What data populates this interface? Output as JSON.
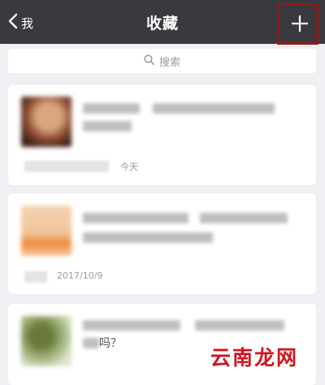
{
  "nav": {
    "back_label": "我",
    "title": "收藏"
  },
  "search": {
    "placeholder": "搜索"
  },
  "items": [
    {
      "meta": "今天"
    },
    {
      "meta": "2017/10/9"
    },
    {
      "snippet": "吗？"
    }
  ],
  "watermark": "云南龙网",
  "colors": {
    "nav_bg": "#393a3f",
    "highlight": "#8e1b1b",
    "watermark": "#d0141c"
  },
  "icons": {
    "back": "chevron-left-icon",
    "add": "plus-icon",
    "search": "magnifier-icon",
    "pointer": "arrow-up-icon"
  }
}
